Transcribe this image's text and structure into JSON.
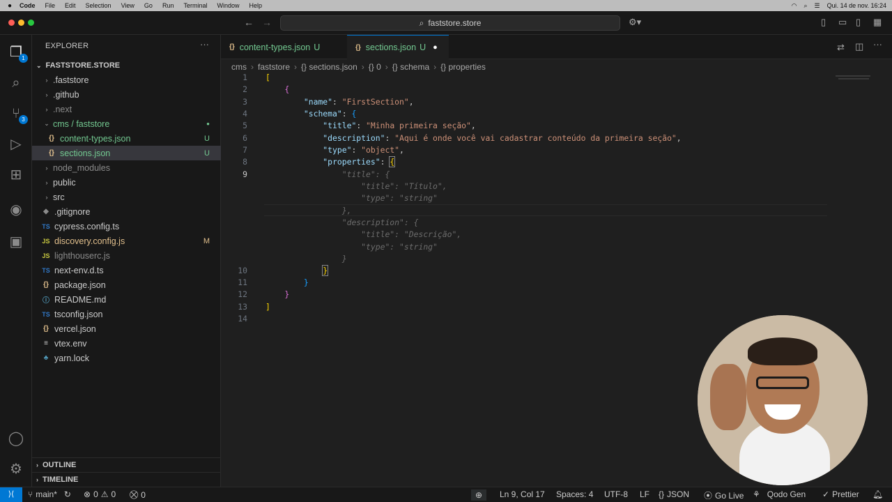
{
  "menubar": {
    "apple": "",
    "app": "Code",
    "items": [
      "File",
      "Edit",
      "Selection",
      "View",
      "Go",
      "Run",
      "Terminal",
      "Window",
      "Help"
    ],
    "datetime": "Qui. 14 de nov.  16:24"
  },
  "titlebar": {
    "search_text": "faststore.store"
  },
  "activity": {
    "explorer_badge": "1",
    "scm_badge": "3"
  },
  "sidebar": {
    "title": "EXPLORER",
    "more": "···",
    "root": "FASTSTORE.STORE",
    "items": [
      {
        "label": ".faststore",
        "icon": "",
        "status": ""
      },
      {
        "label": ".github",
        "icon": "",
        "status": ""
      },
      {
        "label": ".next",
        "icon": "",
        "status": ""
      },
      {
        "label": "cms / faststore",
        "icon": "",
        "status": "●"
      },
      {
        "label": "content-types.json",
        "icon": "{}",
        "status": "U"
      },
      {
        "label": "sections.json",
        "icon": "{}",
        "status": "U"
      },
      {
        "label": "node_modules",
        "icon": "",
        "status": ""
      },
      {
        "label": "public",
        "icon": "",
        "status": ""
      },
      {
        "label": "src",
        "icon": "",
        "status": ""
      },
      {
        "label": ".gitignore",
        "icon": "◆",
        "status": ""
      },
      {
        "label": "cypress.config.ts",
        "icon": "TS",
        "status": ""
      },
      {
        "label": "discovery.config.js",
        "icon": "JS",
        "status": "M"
      },
      {
        "label": "lighthouserc.js",
        "icon": "JS",
        "status": ""
      },
      {
        "label": "next-env.d.ts",
        "icon": "TS",
        "status": ""
      },
      {
        "label": "package.json",
        "icon": "{}",
        "status": ""
      },
      {
        "label": "README.md",
        "icon": "ⓘ",
        "status": ""
      },
      {
        "label": "tsconfig.json",
        "icon": "TS",
        "status": ""
      },
      {
        "label": "vercel.json",
        "icon": "{}",
        "status": ""
      },
      {
        "label": "vtex.env",
        "icon": "≡",
        "status": ""
      },
      {
        "label": "yarn.lock",
        "icon": "♣",
        "status": ""
      }
    ],
    "outline": "OUTLINE",
    "timeline": "TIMELINE"
  },
  "tabs": [
    {
      "label": "content-types.json",
      "status": "U"
    },
    {
      "label": "sections.json",
      "status": "U"
    }
  ],
  "breadcrumb": [
    "cms",
    "faststore",
    "{} sections.json",
    "{} 0",
    "{} schema",
    "{} properties"
  ],
  "code": {
    "lines": [
      "1",
      "2",
      "3",
      "4",
      "5",
      "6",
      "7",
      "8",
      "9",
      "10",
      "11",
      "12",
      "13",
      "14"
    ],
    "name_key": "\"name\"",
    "name_val": "\"FirstSection\"",
    "schema_key": "\"schema\"",
    "title_key": "\"title\"",
    "title_val": "\"Minha primeira seção\"",
    "desc_key": "\"description\"",
    "desc_val": "\"Aqui é onde você vai cadastrar conteúdo da primeira seção\"",
    "type_key": "\"type\"",
    "type_val": "\"object\"",
    "props_key": "\"properties\"",
    "ghost": [
      "\"title\": {",
      "    \"title\": \"Título\",",
      "    \"type\": \"string\"",
      "},",
      "\"description\": {",
      "    \"title\": \"Descrição\",",
      "    \"type\": \"string\"",
      "}"
    ]
  },
  "status": {
    "branch": "main*",
    "errors": "0",
    "warnings": "0",
    "ports": "0",
    "position": "Ln 9, Col 17",
    "spaces": "Spaces: 4",
    "encoding": "UTF-8",
    "eol": "LF",
    "language": "JSON",
    "golive": "Go Live",
    "qodo": "Qodo Gen",
    "prettier": "Prettier"
  }
}
